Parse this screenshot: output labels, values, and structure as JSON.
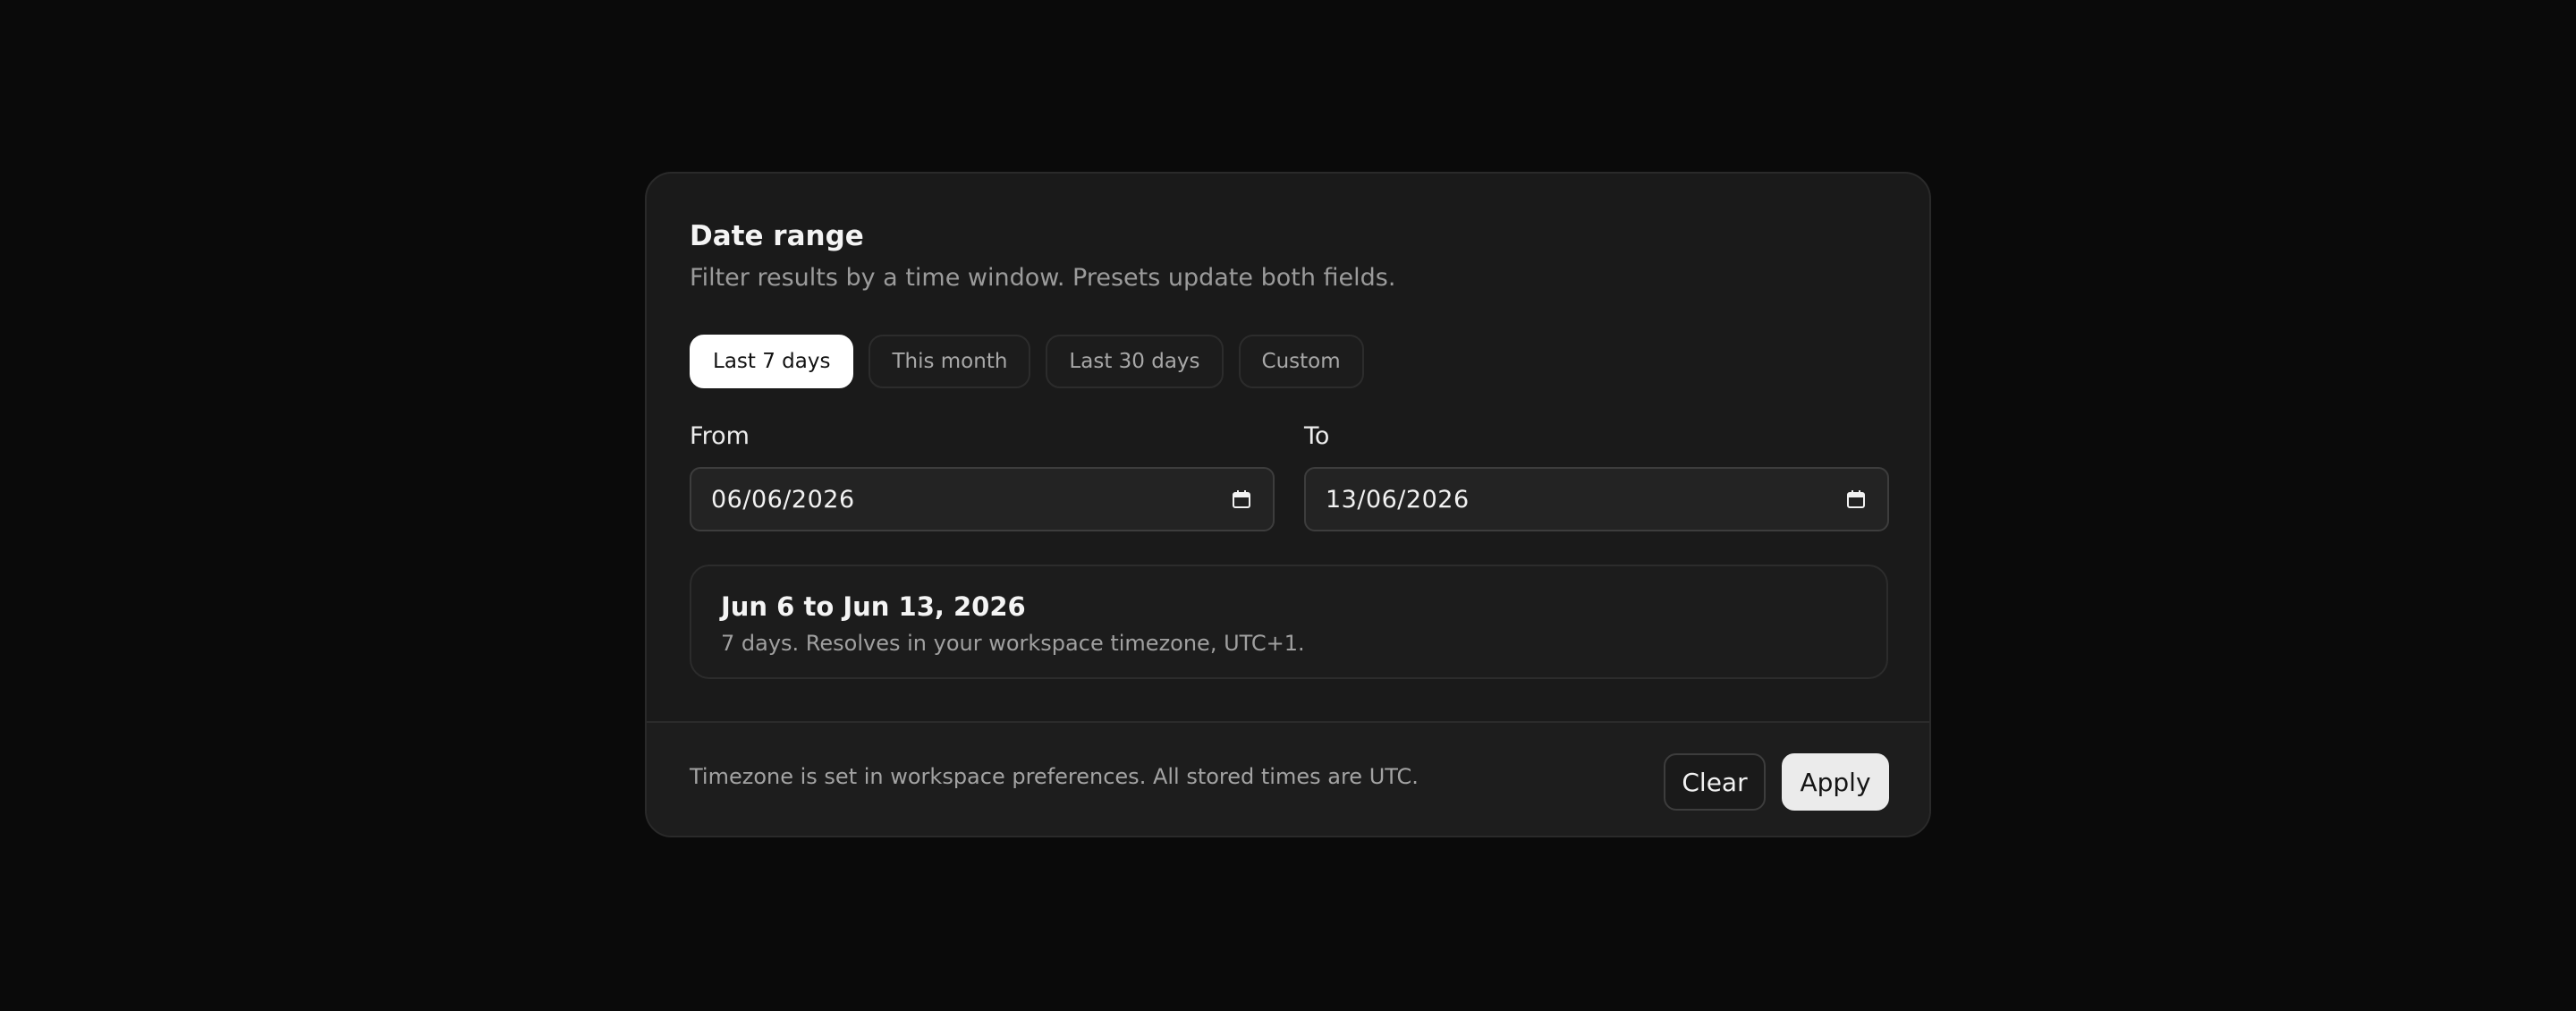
{
  "panel": {
    "title": "Date range",
    "subtitle": "Filter results by a time window. Presets update both fields."
  },
  "presets": {
    "selected": "Last 7 days",
    "items": [
      {
        "label": "Last 7 days",
        "active": true
      },
      {
        "label": "This month",
        "active": false
      },
      {
        "label": "Last 30 days",
        "active": false
      },
      {
        "label": "Custom",
        "active": false
      }
    ]
  },
  "fields": {
    "from": {
      "label": "From",
      "value": "06/06/2026",
      "icon": "calendar-icon"
    },
    "to": {
      "label": "To",
      "value": "13/06/2026",
      "icon": "calendar-icon"
    }
  },
  "summary": {
    "title": "Jun 6 to Jun 13, 2026",
    "detail": "7 days. Resolves in your workspace timezone, UTC+1."
  },
  "footer": {
    "note": "Timezone is set in workspace preferences. All stored times are UTC.",
    "clear_label": "Clear",
    "apply_label": "Apply"
  },
  "colors": {
    "background": "#0a0a0a",
    "panel": "#1a1a1a",
    "active_preset": "#ffffff",
    "apply_button": "#ebebeb"
  }
}
